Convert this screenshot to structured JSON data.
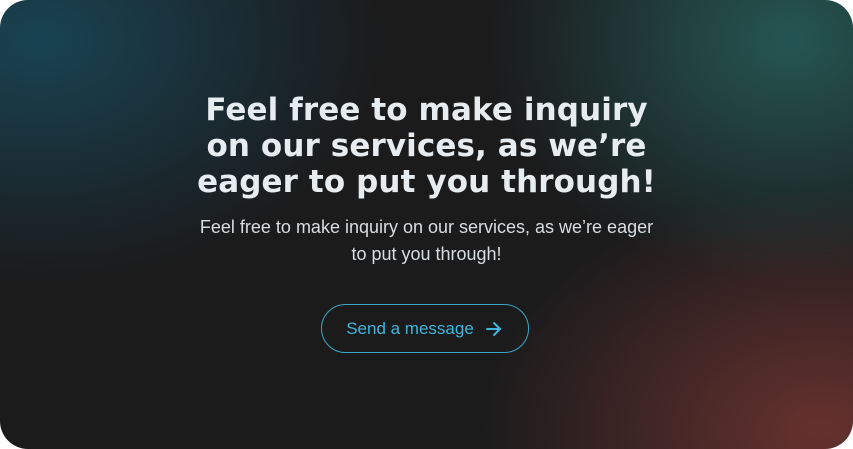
{
  "hero": {
    "headline": "Feel free to make inquiry on our services, as we’re eager to put you through!",
    "subtext": "Feel free to make inquiry on our services, as we’re eager to put you through!",
    "cta_label": "Send a message",
    "cta_icon": "arrow-right-icon"
  },
  "colors": {
    "accent": "#3cb6dc",
    "text": "#e6ecef"
  }
}
